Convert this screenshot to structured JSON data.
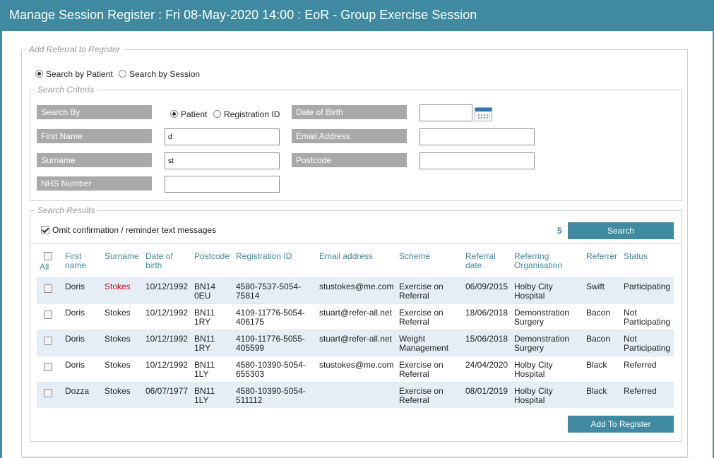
{
  "title": "Manage Session Register : Fri 08-May-2020 14:00 : EoR - Group Exercise Session",
  "add_referral": {
    "legend": "Add Referral to Register",
    "search_mode": [
      {
        "label": "Search by Patient",
        "selected": true
      },
      {
        "label": "Search by Session",
        "selected": false
      }
    ]
  },
  "criteria": {
    "legend": "Search Criteria",
    "search_by_label": "Search By",
    "search_by_options": [
      {
        "label": "Patient",
        "selected": true
      },
      {
        "label": "Registration ID",
        "selected": false
      }
    ],
    "first_name_label": "First Name",
    "first_name_value": "d",
    "surname_label": "Surname",
    "surname_value": "st",
    "nhs_label": "NHS Number",
    "nhs_value": "",
    "dob_label": "Date of Birth",
    "dob_value": "",
    "email_label": "Email Address",
    "email_value": "",
    "postcode_label": "Postcode",
    "postcode_value": ""
  },
  "results": {
    "legend": "Search Results",
    "omit_label": "Omit confirmation / reminder text messages",
    "omit_checked": true,
    "count": "5",
    "search_button": "Search",
    "add_button": "Add To Register",
    "columns": {
      "all": "All",
      "first_name": [
        "First",
        "name"
      ],
      "surname": "Surname",
      "dob": [
        "Date of",
        "birth"
      ],
      "postcode": "Postcode",
      "reg_id": "Registration ID",
      "email": "Email address",
      "scheme": "Scheme",
      "ref_date": [
        "Referral",
        "date"
      ],
      "ref_org": [
        "Referring",
        "Organisation"
      ],
      "referrer": "Referrer",
      "status": "Status"
    },
    "rows": [
      {
        "first": "Doris",
        "surname": "Stokes",
        "surname_highlight": true,
        "dob": "10/12/1992",
        "postcode": [
          "BN14",
          "0EU"
        ],
        "reg_id": [
          "4580-7537-5054-",
          "75814"
        ],
        "email": "stustokes@me.com",
        "scheme": [
          "Exercise on",
          "Referral"
        ],
        "ref_date": "06/09/2015",
        "ref_org": [
          "Holby City",
          "Hospital"
        ],
        "referrer": "Swift",
        "status": [
          "Participating"
        ]
      },
      {
        "first": "Doris",
        "surname": "Stokes",
        "surname_highlight": false,
        "dob": "10/12/1992",
        "postcode": [
          "BN11",
          "1RY"
        ],
        "reg_id": [
          "4109-11776-5054-",
          "406175"
        ],
        "email": "stuart@refer-all.net",
        "scheme": [
          "Exercise on",
          "Referral"
        ],
        "ref_date": "18/06/2018",
        "ref_org": [
          "Demonstration",
          "Surgery"
        ],
        "referrer": "Bacon",
        "status": [
          "Not",
          "Participating"
        ]
      },
      {
        "first": "Doris",
        "surname": "Stokes",
        "surname_highlight": false,
        "dob": "10/12/1992",
        "postcode": [
          "BN11",
          "1RY"
        ],
        "reg_id": [
          "4109-11776-5055-",
          "405599"
        ],
        "email": "stuart@refer-all.net",
        "scheme": [
          "Weight",
          "Management"
        ],
        "ref_date": "15/06/2018",
        "ref_org": [
          "Demonstration",
          "Surgery"
        ],
        "referrer": "Bacon",
        "status": [
          "Not",
          "Participating"
        ]
      },
      {
        "first": "Doris",
        "surname": "Stokes",
        "surname_highlight": false,
        "dob": "10/12/1992",
        "postcode": [
          "BN11",
          "1LY"
        ],
        "reg_id": [
          "4580-10390-5054-",
          "655303"
        ],
        "email": "stustokes@me.com",
        "scheme": [
          "Exercise on",
          "Referral"
        ],
        "ref_date": "24/04/2020",
        "ref_org": [
          "Holby City",
          "Hospital"
        ],
        "referrer": "Black",
        "status": [
          "Referred"
        ]
      },
      {
        "first": "Dozza",
        "surname": "Stokes",
        "surname_highlight": false,
        "dob": "06/07/1977",
        "postcode": [
          "BN11",
          "1LY"
        ],
        "reg_id": [
          "4580-10390-5054-",
          "511112"
        ],
        "email": "",
        "scheme": [
          "Exercise on",
          "Referral"
        ],
        "ref_date": "08/01/2019",
        "ref_org": [
          "Holby City",
          "Hospital"
        ],
        "referrer": "Black",
        "status": [
          "Referred"
        ]
      }
    ]
  }
}
